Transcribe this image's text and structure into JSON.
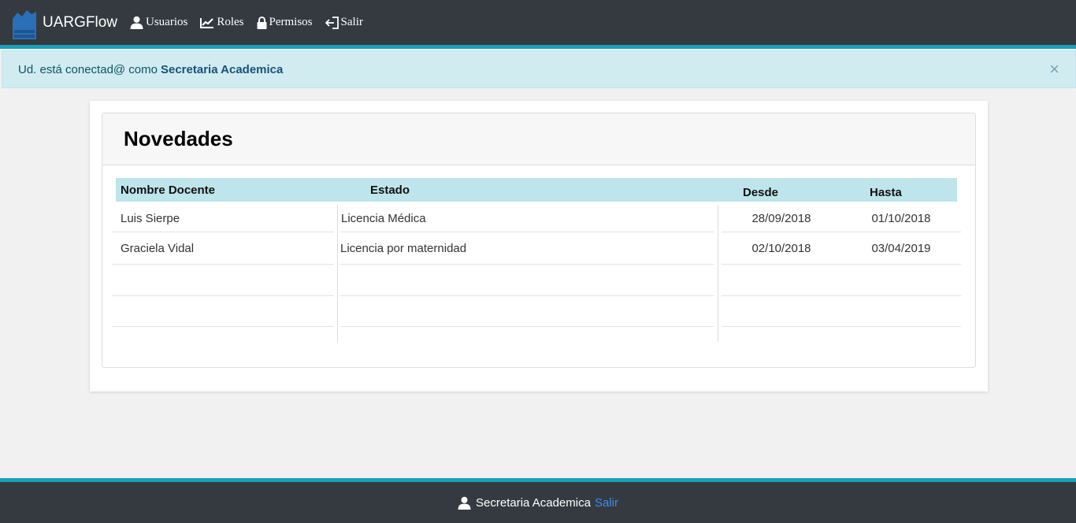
{
  "navbar": {
    "brand": "UARGFlow",
    "logo_icon": "unpa-uarg-logo",
    "items": [
      {
        "label": "Usuarios",
        "icon": "user-icon"
      },
      {
        "label": "Roles",
        "icon": "chart-line-icon"
      },
      {
        "label": "Permisos",
        "icon": "lock-icon"
      },
      {
        "label": "Salir",
        "icon": "sign-out-icon"
      }
    ]
  },
  "alert": {
    "prefix": "Ud. está conectad@ como",
    "user": "Secretaria Academica",
    "close": "×"
  },
  "card": {
    "title": "Novedades",
    "headers": [
      "Nombre Docente",
      "Estado",
      "Desde",
      "Hasta"
    ],
    "rows": [
      {
        "nombre": "Luis Sierpe",
        "estado": "Licencia Médica",
        "desde": "28/09/2018",
        "hasta": "01/10/2018"
      },
      {
        "nombre": "Graciela Vidal",
        "estado": "Licencia por maternidad",
        "desde": "02/10/2018",
        "hasta": "03/04/2019"
      }
    ]
  },
  "footer": {
    "user": "Secretaria Academica",
    "logout": "Salir",
    "icon": "user-icon"
  },
  "colors": {
    "navbar": "#343a40",
    "accent": "#17a2b8",
    "alert_bg": "#d1ecf1",
    "table_header": "#bee5eb",
    "link": "#3b8cf0"
  }
}
